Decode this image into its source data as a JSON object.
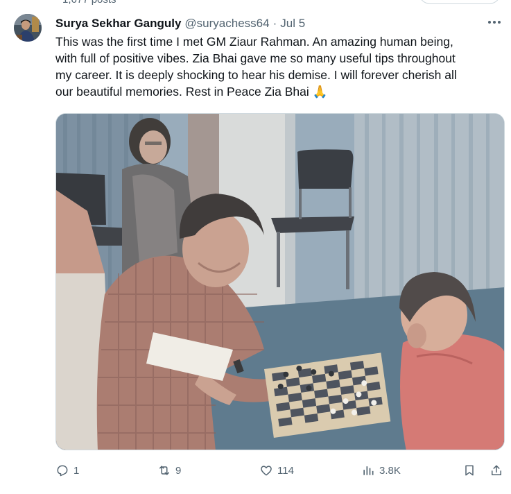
{
  "profile_header": {
    "posts_count": "1,677 posts"
  },
  "tweet": {
    "author_name": "Surya Sekhar Ganguly",
    "handle": "@suryachess64",
    "separator": "·",
    "date": "Jul 5",
    "text_lines": [
      "This was the first time I met GM Ziaur Rahman. An amazing human being,",
      "with full of positive vibes. Zia Bhai gave me so many useful tips throughout",
      "my career. It is deeply shocking to hear his demise. I will forever cherish all",
      "our beautiful memories. Rest in Peace Zia Bhai 🙏"
    ],
    "media": {
      "kind": "photo"
    }
  },
  "actions": {
    "replies": "1",
    "reposts": "9",
    "likes": "114",
    "views": "3.8K"
  },
  "colors": {
    "text_primary": "#0f1419",
    "text_secondary": "#536471",
    "border": "#cfd9de",
    "pray_emoji": "#f5b93b"
  },
  "icons": [
    "more-icon",
    "reply-icon",
    "repost-icon",
    "like-icon",
    "views-icon",
    "bookmark-icon",
    "share-icon"
  ]
}
